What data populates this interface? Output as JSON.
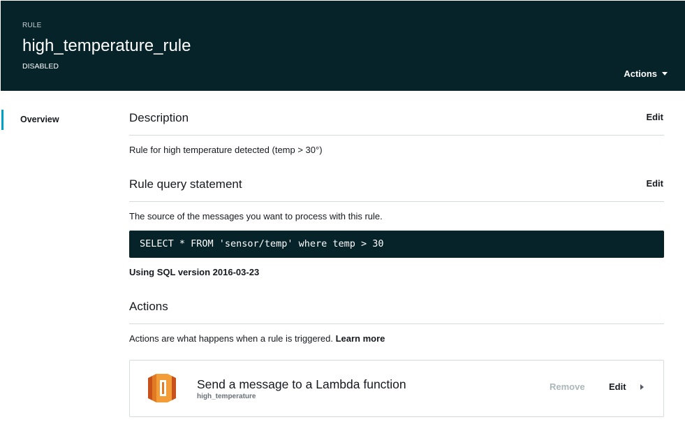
{
  "header": {
    "kicker": "RULE",
    "title": "high_temperature_rule",
    "status": "DISABLED",
    "actions_label": "Actions"
  },
  "sidenav": {
    "items": [
      {
        "label": "Overview",
        "active": true
      }
    ]
  },
  "description": {
    "title": "Description",
    "edit_label": "Edit",
    "text": "Rule for high temperature detected (temp > 30°)"
  },
  "query": {
    "title": "Rule query statement",
    "edit_label": "Edit",
    "help_text": "The source of the messages you want to process with this rule.",
    "sql": "SELECT * FROM 'sensor/temp' where temp > 30",
    "sql_version_text": "Using SQL version 2016-03-23"
  },
  "actions_section": {
    "title": "Actions",
    "help_text": "Actions are what happens when a rule is triggered.",
    "learn_more_label": "Learn more",
    "items": [
      {
        "icon": "lambda-icon",
        "title": "Send a message to a Lambda function",
        "subtitle": "high_temperature",
        "remove_label": "Remove",
        "edit_label": "Edit"
      }
    ]
  },
  "colors": {
    "header_bg": "#06232a",
    "accent": "#00a1c9",
    "lambda_orange": "#e07b24",
    "disabled_text": "#aab7b8"
  }
}
